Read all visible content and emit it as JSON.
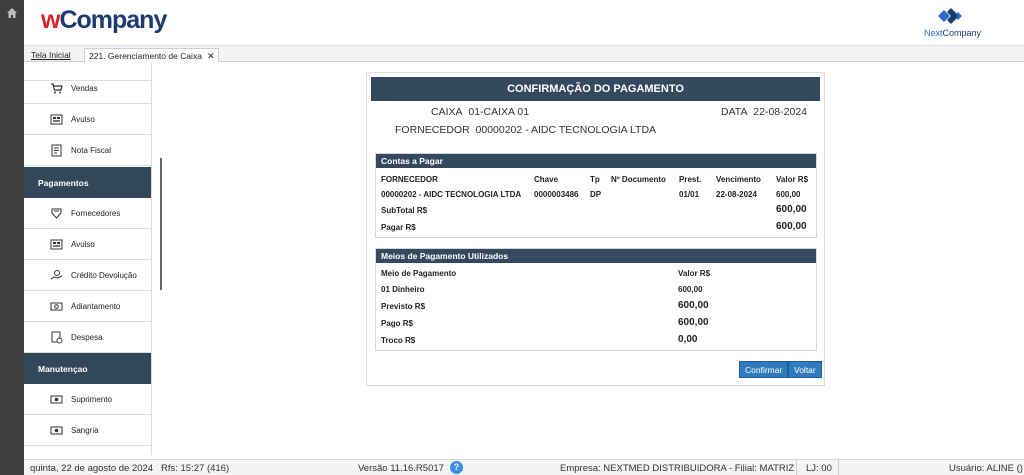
{
  "header": {
    "logo_prefix": "w",
    "logo_rest": "Company",
    "partner_a": "Next",
    "partner_b": "Company"
  },
  "tabs": [
    {
      "label": "Tela Inicial"
    },
    {
      "label": "221. Gerenciamento de Caixa",
      "close": "✕"
    }
  ],
  "sidebar": {
    "items_top": [
      {
        "label": "Vendas",
        "icon": "cart-icon"
      },
      {
        "label": "Avulso",
        "icon": "register-icon"
      },
      {
        "label": "Nota Fiscal",
        "icon": "invoice-icon"
      }
    ],
    "section_pagamentos": "Pagamentos",
    "items_pag": [
      {
        "label": "Fornecedores",
        "icon": "supplier-icon"
      },
      {
        "label": "Avulso",
        "icon": "register-icon"
      },
      {
        "label": "Crédito Devolução",
        "icon": "hand-money-icon"
      },
      {
        "label": "Adiantamento",
        "icon": "advance-icon"
      },
      {
        "label": "Despesa",
        "icon": "expense-icon"
      }
    ],
    "section_manutencao": "Manutençao",
    "items_man": [
      {
        "label": "Suprimento",
        "icon": "cash-icon"
      },
      {
        "label": "Sangria",
        "icon": "cash-icon"
      }
    ]
  },
  "dialog": {
    "title": "CONFIRMAÇÃO DO PAGAMENTO",
    "caixa_label": "CAIXA",
    "caixa_value": "01-CAIXA 01",
    "data_label": "DATA",
    "data_value": "22-08-2024",
    "fornecedor_label": "FORNECEDOR",
    "fornecedor_value": "00000202 - AIDC TECNOLOGIA LTDA"
  },
  "contas": {
    "title": "Contas a Pagar",
    "columns": [
      "FORNECEDOR",
      "Chave",
      "Tp",
      "Nº Documento",
      "Prest.",
      "Vencimento",
      "Valor R$"
    ],
    "rows": [
      [
        "00000202 - AIDC TECNOLOGIA LTDA",
        "0000003486",
        "DP",
        "",
        "01/01",
        "22-08-2024",
        "600,00"
      ]
    ],
    "subtotal_label": "SubTotal R$",
    "subtotal_value": "600,00",
    "pagar_label": "Pagar R$",
    "pagar_value": "600,00"
  },
  "meios": {
    "title": "Meios de Pagamento Utilizados",
    "col_meio": "Meio de Pagamento",
    "col_valor": "Valor R$",
    "item_label": "01 Dinheiro",
    "item_value": "600,00",
    "previsto_label": "Previsto R$",
    "previsto_value": "600,00",
    "pago_label": "Pago R$",
    "pago_value": "600,00",
    "troco_label": "Troco R$",
    "troco_value": "0,00"
  },
  "buttons": {
    "confirmar": "Confirmar",
    "voltar": "Voltar"
  },
  "status": {
    "datetime": "quinta, 22 de agosto de 2024",
    "rfs": "Rfs: 15:27 (416)",
    "versao": "Versão 11.16.R5017",
    "help": "?",
    "empresa": "Empresa: NEXTMED DISTRIBUIDORA - Filial: MATRIZ",
    "lj": "LJ: 00",
    "usuario": "Usuário: ALINE ()"
  }
}
